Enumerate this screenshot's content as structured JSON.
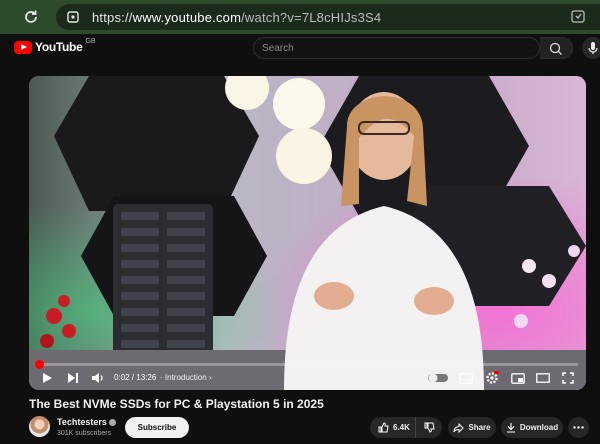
{
  "browser": {
    "url_prefix": "https://",
    "url_host": "www.youtube.com",
    "url_path": "/watch?v=7L8cHIJs3S4"
  },
  "header": {
    "wordmark": "YouTube",
    "country_code": "GB",
    "search_placeholder": "Search"
  },
  "player": {
    "current_time": "0:02",
    "duration": "13:26",
    "time_separator": " / ",
    "chapter": "Introduction",
    "progress_fraction": 0.003
  },
  "video": {
    "title": "The Best NVMe SSDs for PC & Playstation 5 in 2025",
    "channel_name": "Techtesters",
    "subscribers": "301K subscribers",
    "subscribe_label": "Subscribe",
    "likes": "6.4K",
    "share_label": "Share",
    "download_label": "Download"
  },
  "colors": {
    "brand_red": "#ff0000",
    "browser_bar": "#2e4a2c",
    "page_bg": "#0f0f0f"
  },
  "icons": [
    "reload-icon",
    "lock-icon",
    "extension-icon",
    "youtube-logo-icon",
    "search-icon",
    "mic-icon",
    "play-icon",
    "next-icon",
    "volume-icon",
    "autoplay-toggle",
    "subtitles-icon",
    "settings-icon",
    "miniplayer-icon",
    "theater-icon",
    "fullscreen-icon",
    "verified-icon",
    "like-icon",
    "dislike-icon",
    "share-icon",
    "download-icon",
    "more-icon"
  ]
}
